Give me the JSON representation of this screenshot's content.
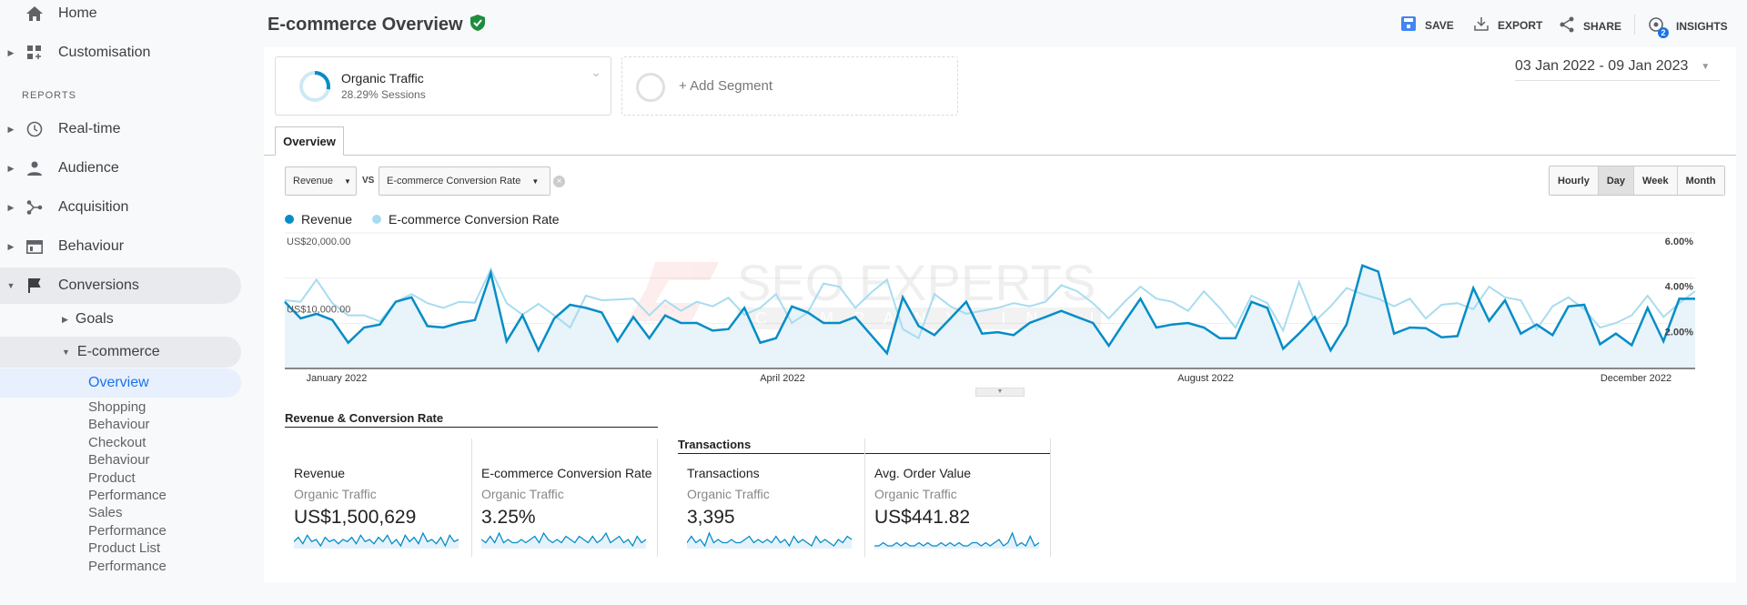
{
  "sidebar": {
    "home": "Home",
    "customisation": "Customisation",
    "reports_heading": "REPORTS",
    "realtime": "Real-time",
    "audience": "Audience",
    "acquisition": "Acquisition",
    "behaviour": "Behaviour",
    "conversions": "Conversions",
    "goals": "Goals",
    "ecommerce": "E-commerce",
    "overview": "Overview",
    "subitems": [
      "Shopping",
      "Behaviour",
      "Checkout",
      "Behaviour",
      "Product",
      "Performance",
      "Sales",
      "Performance",
      "Product List",
      "Performance"
    ]
  },
  "header": {
    "title": "E-commerce Overview",
    "save": "SAVE",
    "export": "EXPORT",
    "share": "SHARE",
    "insights": "INSIGHTS",
    "insights_badge": "2"
  },
  "segment": {
    "name": "Organic Traffic",
    "sub": "28.29% Sessions",
    "share_pct": 28.29,
    "add": "+ Add Segment"
  },
  "date_range": "03 Jan 2022 -  09 Jan 2023",
  "tab": "Overview",
  "controls": {
    "metric1": "Revenue",
    "vs": "VS",
    "metric2": "E-commerce Conversion Rate",
    "granularity": [
      "Hourly",
      "Day",
      "Week",
      "Month"
    ],
    "selected": "Day"
  },
  "watermark": {
    "line1": "SEO EXPERTS",
    "line2": "COMPANY INDIA"
  },
  "colors": {
    "revenue": "#058dc7",
    "conversion": "#a8dcf0",
    "fill": "#e6f2fa",
    "accent": "#1a73e8",
    "verified": "#1e8e3e"
  },
  "chart_data": {
    "type": "line",
    "legend": [
      "Revenue",
      "E-commerce Conversion Rate"
    ],
    "left_axis": {
      "ticks": [
        "US$20,000.00",
        "US$10,000.00"
      ],
      "range": [
        0,
        20000
      ]
    },
    "right_axis": {
      "ticks": [
        "6.00%",
        "4.00%",
        "2.00%"
      ],
      "range": [
        0,
        6
      ]
    },
    "x_ticks": [
      "January  2022",
      "April 2022",
      "August 2022",
      "December 2022"
    ],
    "series": [
      {
        "name": "Revenue",
        "axis": "left",
        "values": [
          9840,
          7380,
          8050,
          7150,
          3800,
          6040,
          6480,
          9840,
          10500,
          6260,
          6040,
          6710,
          7150,
          14080,
          4020,
          7830,
          2680,
          7380,
          9390,
          8940,
          8270,
          4020,
          7600,
          4470,
          7830,
          6710,
          6710,
          5590,
          5810,
          8940,
          3800,
          4470,
          9160,
          8270,
          6710,
          6710,
          7600,
          4920,
          2240,
          10500,
          6260,
          4920,
          7380,
          9840,
          5140,
          5360,
          4920,
          6710,
          7600,
          8490,
          7600,
          6710,
          3350,
          6930,
          10280,
          6040,
          6480,
          6710,
          6040,
          4470,
          4470,
          9840,
          8940,
          2910,
          5140,
          7600,
          2680,
          6480,
          15200,
          14300,
          5140,
          6040,
          5950,
          4600,
          4780,
          11850,
          7020,
          10060,
          5140,
          6480,
          4920,
          9160,
          9390,
          3580,
          5140,
          3440,
          8940,
          4020,
          10280,
          10280
        ]
      },
      {
        "name": "E-commerce Conversion Rate",
        "axis": "right",
        "values": [
          3.02,
          2.95,
          3.93,
          2.89,
          2.35,
          2.35,
          2.08,
          2.95,
          3.29,
          2.89,
          2.68,
          2.95,
          2.91,
          4.39,
          2.89,
          2.38,
          2.86,
          2.35,
          1.81,
          3.22,
          3.02,
          3.05,
          3.09,
          2.35,
          3.02,
          2.55,
          2.95,
          2.75,
          3.13,
          2.38,
          2.68,
          3.29,
          2.01,
          2.48,
          3.76,
          3.62,
          2.68,
          3.36,
          3.93,
          1.74,
          1.34,
          3.29,
          2.75,
          2.42,
          2.55,
          2.68,
          2.89,
          2.75,
          2.95,
          3.69,
          3.42,
          2.89,
          2.21,
          2.95,
          3.62,
          3.09,
          2.95,
          2.55,
          3.42,
          2.68,
          1.81,
          3.22,
          2.89,
          1.68,
          3.83,
          2.08,
          2.75,
          3.56,
          3.29,
          3.09,
          2.75,
          3.09,
          2.21,
          2.82,
          2.89,
          2.62,
          3.62,
          3.15,
          3.02,
          1.74,
          2.75,
          3.15,
          2.62,
          1.81,
          2.01,
          2.35,
          3.22,
          2.28,
          2.89,
          3.42
        ]
      }
    ]
  },
  "sections": {
    "group1": "Revenue & Conversion Rate",
    "group2": "Transactions"
  },
  "scorecards": [
    {
      "metric": "Revenue",
      "segment": "Organic Traffic",
      "value": "US$1,500,629",
      "spark": [
        5,
        7,
        4,
        8,
        5,
        6,
        3,
        7,
        5,
        6,
        4,
        6,
        5,
        7,
        4,
        8,
        5,
        6,
        4,
        7,
        5,
        8,
        4,
        6,
        3,
        8,
        5,
        7,
        4,
        9,
        5,
        6,
        4,
        7,
        3,
        8,
        5,
        6
      ]
    },
    {
      "metric": "E-commerce Conversion Rate",
      "segment": "Organic Traffic",
      "value": "3.25%",
      "spark": [
        6,
        5,
        7,
        5,
        8,
        5,
        6,
        5,
        5,
        6,
        5,
        6,
        7,
        5,
        8,
        6,
        5,
        6,
        5,
        7,
        6,
        5,
        7,
        6,
        5,
        7,
        5,
        6,
        8,
        5,
        6,
        7,
        5,
        6,
        4,
        7,
        5,
        6
      ]
    },
    {
      "metric": "Transactions",
      "segment": "Organic Traffic",
      "value": "3,395",
      "spark": [
        5,
        7,
        5,
        6,
        4,
        8,
        5,
        6,
        5,
        5,
        6,
        5,
        5,
        6,
        7,
        5,
        6,
        5,
        6,
        5,
        7,
        5,
        6,
        4,
        7,
        5,
        6,
        5,
        4,
        7,
        5,
        6,
        5,
        4,
        6,
        5,
        7,
        6
      ]
    },
    {
      "metric": "Avg. Order Value",
      "segment": "Organic Traffic",
      "value": "US$441.82",
      "spark": [
        5,
        5,
        6,
        5,
        5,
        6,
        5,
        6,
        5,
        5,
        6,
        5,
        6,
        5,
        5,
        6,
        5,
        6,
        5,
        6,
        5,
        5,
        6,
        6,
        5,
        6,
        5,
        6,
        7,
        5,
        6,
        9,
        5,
        6,
        5,
        8,
        5,
        6
      ]
    }
  ]
}
